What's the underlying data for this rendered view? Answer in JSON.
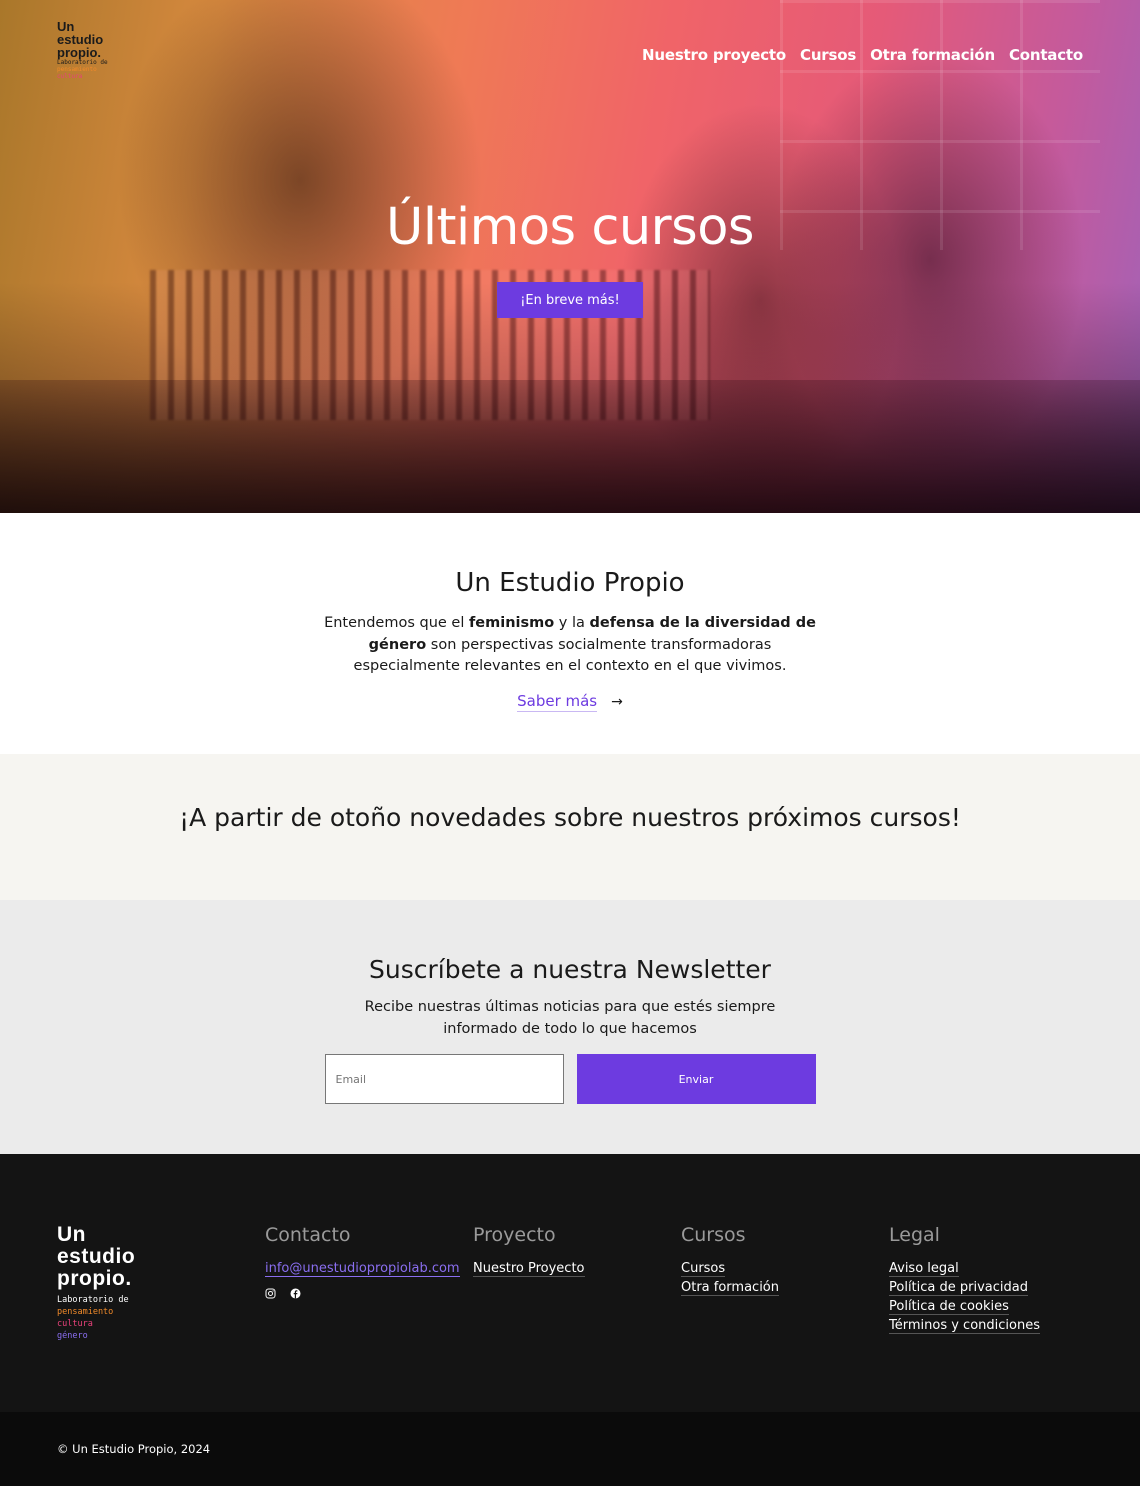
{
  "brand": {
    "logo_line1": "Un",
    "logo_line2": "estudio",
    "logo_line3": "propio.",
    "tag_laboratorio": "Laboratorio de",
    "tag_pensamiento": "pensamiento",
    "tag_cultura": "cultura",
    "tag_genero": "género",
    "accent": "#6d3be0"
  },
  "nav": {
    "items": [
      "Nuestro proyecto",
      "Cursos",
      "Otra formación",
      "Contacto"
    ]
  },
  "hero": {
    "title": "Últimos cursos",
    "button": "¡En breve más!"
  },
  "about": {
    "title": "Un Estudio Propio",
    "text_1": "Entendemos que el ",
    "bold_1": "feminismo",
    "text_2": " y la ",
    "bold_2": "defensa de la diversidad de género",
    "text_3": " son perspectivas socialmente transformadoras especialmente relevantes en el contexto en el que vivimos.",
    "link": "Saber más",
    "arrow": "→"
  },
  "announce": {
    "title": "¡A partir de otoño novedades sobre nuestros próximos cursos!"
  },
  "newsletter": {
    "title": "Suscríbete a nuestra Newsletter",
    "text": "Recibe nuestras últimas noticias para que estés siempre informado de todo lo que hacemos",
    "email_placeholder": "Email",
    "button": "Enviar"
  },
  "footer": {
    "contact": {
      "title": "Contacto",
      "email": "info@unestudiopropiolab.com",
      "social_icons": [
        "instagram-icon",
        "facebook-icon"
      ]
    },
    "project": {
      "title": "Proyecto",
      "links": [
        "Nuestro Proyecto"
      ]
    },
    "courses": {
      "title": "Cursos",
      "links": [
        "Cursos",
        "Otra formación"
      ]
    },
    "legal": {
      "title": "Legal",
      "links": [
        "Aviso legal",
        "Política de privacidad",
        "Política de cookies",
        "Términos y condiciones"
      ]
    },
    "copyright": "© Un Estudio Propio, 2024"
  }
}
